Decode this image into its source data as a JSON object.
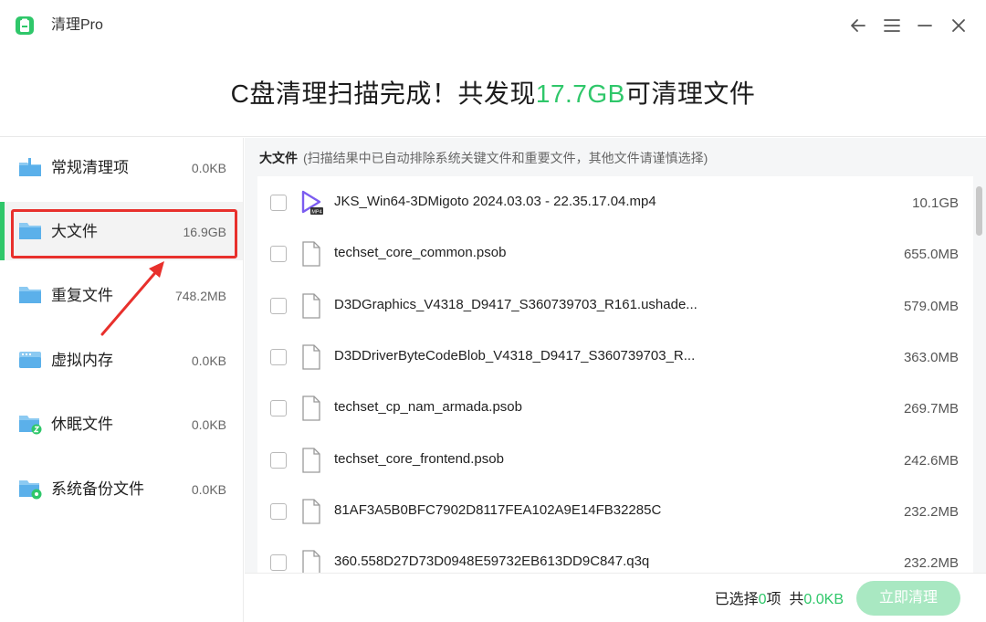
{
  "app": {
    "title": "清理Pro"
  },
  "header": {
    "text_before": "C盘清理扫描完成！共发现",
    "highlight": "17.7GB",
    "text_after": "可清理文件"
  },
  "sidebar": {
    "items": [
      {
        "label": "常规清理项",
        "size": "0.0KB",
        "icon": "broom-folder-icon"
      },
      {
        "label": "大文件",
        "size": "16.9GB",
        "icon": "folder-icon",
        "active": true
      },
      {
        "label": "重复文件",
        "size": "748.2MB",
        "icon": "duplicate-folder-icon"
      },
      {
        "label": "虚拟内存",
        "size": "0.0KB",
        "icon": "memory-icon"
      },
      {
        "label": "休眠文件",
        "size": "0.0KB",
        "icon": "sleep-folder-icon"
      },
      {
        "label": "系统备份文件",
        "size": "0.0KB",
        "icon": "backup-folder-icon"
      }
    ]
  },
  "main": {
    "section_title": "大文件",
    "section_hint": "(扫描结果中已自动排除系统关键文件和重要文件，其他文件请谨慎选择)",
    "files": [
      {
        "name": "JKS_Win64-3DMigoto 2024.03.03 - 22.35.17.04.mp4",
        "size": "10.1GB",
        "icon": "video-file-icon",
        "badge": "MP4"
      },
      {
        "name": "techset_core_common.psob",
        "size": "655.0MB",
        "icon": "file-icon"
      },
      {
        "name": "D3DGraphics_V4318_D9417_S360739703_R161.ushade...",
        "size": "579.0MB",
        "icon": "file-icon"
      },
      {
        "name": "D3DDriverByteCodeBlob_V4318_D9417_S360739703_R...",
        "size": "363.0MB",
        "icon": "file-icon"
      },
      {
        "name": "techset_cp_nam_armada.psob",
        "size": "269.7MB",
        "icon": "file-icon"
      },
      {
        "name": "techset_core_frontend.psob",
        "size": "242.6MB",
        "icon": "file-icon"
      },
      {
        "name": "81AF3A5B0BFC7902D8117FEA102A9E14FB32285C",
        "size": "232.2MB",
        "icon": "file-icon"
      },
      {
        "name": "360.558D27D73D0948E59732EB613DD9C847.q3q",
        "size": "232.2MB",
        "icon": "file-icon"
      }
    ]
  },
  "footer": {
    "selected_prefix": "已选择",
    "selected_count": "0",
    "selected_unit": "项",
    "total_prefix": "共",
    "total_size": "0.0KB",
    "clean_button": "立即清理"
  },
  "colors": {
    "accent": "#2fc76a",
    "button_disabled": "#a9e8c2",
    "annotation": "#e8302c"
  }
}
